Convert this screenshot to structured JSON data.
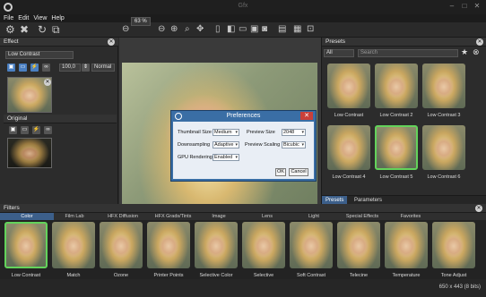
{
  "window": {
    "title": "Gfx"
  },
  "menu": [
    "File",
    "Edit",
    "View",
    "Help"
  ],
  "toolbar": {
    "zoom": "63 %"
  },
  "effect_panel": {
    "title": "Effect",
    "name": "Low Contrast",
    "opacity": "100,0",
    "blend_mode": "Normal",
    "original_title": "Original"
  },
  "dialog": {
    "title": "Preferences",
    "thumbnail_size_label": "Thumbnail Size",
    "thumbnail_size_value": "Medium",
    "preview_size_label": "Preview Size",
    "preview_size_value": "2048",
    "downsampling_label": "Downsampling",
    "downsampling_value": "Adaptive",
    "preview_scaling_label": "Preview Scaling",
    "preview_scaling_value": "Bicubic",
    "gpu_label": "GPU Rendering",
    "gpu_value": "Enabled",
    "ok": "OK",
    "cancel": "Cancel"
  },
  "presets": {
    "title": "Presets",
    "filter_value": "All",
    "search_placeholder": "Search",
    "items": [
      {
        "label": "Low Contrast"
      },
      {
        "label": "Low Contrast 2"
      },
      {
        "label": "Low Contrast 3"
      },
      {
        "label": "Low Contrast 4"
      },
      {
        "label": "Low Contrast 5"
      },
      {
        "label": "Low Contrast 6"
      }
    ],
    "selected_index": 4,
    "tabs": [
      "Presets",
      "Parameters"
    ]
  },
  "filters": {
    "title": "Filters",
    "categories": [
      "Color",
      "Film Lab",
      "HFX Diffusion",
      "HFX Grads/Tints",
      "Image",
      "Lens",
      "Light",
      "Special Effects",
      "Favorites"
    ],
    "active_category": 0,
    "items": [
      {
        "label": "Low Contrast"
      },
      {
        "label": "Match"
      },
      {
        "label": "Ozone"
      },
      {
        "label": "Printer Points"
      },
      {
        "label": "Selective Color"
      },
      {
        "label": "Selective"
      },
      {
        "label": "Soft Contrast"
      },
      {
        "label": "Telecine"
      },
      {
        "label": "Temperature"
      },
      {
        "label": "Tone Adjust"
      }
    ]
  },
  "status": {
    "text": "650 x 443 (8 bits)"
  }
}
